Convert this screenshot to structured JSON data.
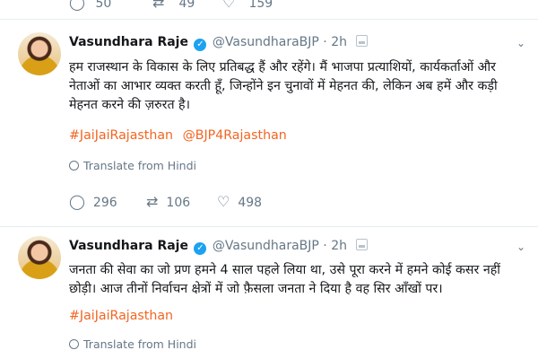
{
  "prev_tweet_actions": {
    "replies": "50",
    "retweets": "49",
    "likes": "159"
  },
  "tweets": [
    {
      "name": "Vasundhara Raje",
      "handle": "@VasundharaBJP",
      "separator": "·",
      "time": "2h",
      "text": "हम राजस्थान के विकास के लिए प्रतिबद्ध हैं और रहेंगे। मैं भाजपा प्रत्याशियों, कार्यकर्ताओं और नेताओं का आभार व्यक्त करती हूँ, जिन्होंने इन चुनावों में मेहनत की, लेकिन अब हमें और कड़ी मेहनत करने की ज़रुरत है।",
      "tags": [
        "#JaiJaiRajasthan",
        "@BJP4Rajasthan"
      ],
      "translate": "Translate from Hindi",
      "replies": "296",
      "retweets": "106",
      "likes": "498"
    },
    {
      "name": "Vasundhara Raje",
      "handle": "@VasundharaBJP",
      "separator": "·",
      "time": "2h",
      "text": "जनता की सेवा का जो प्रण हमने 4 साल पहले लिया था, उसे पूरा करने में हमने कोई कसर नहीं छोड़ी। आज तीनों निर्वाचन क्षेत्रों में जो फ़ैसला जनता ने दिया है वह सिर आँखों पर।",
      "tags": [
        "#JaiJaiRajasthan"
      ],
      "translate": "Translate from Hindi"
    }
  ],
  "icons": {
    "reply": "reply-icon",
    "retweet": "retweet-icon",
    "like": "heart-icon",
    "verified": "verified-badge-icon",
    "caret": "chevron-down-icon",
    "globe": "globe-icon"
  },
  "colors": {
    "hashtag": "#f26522",
    "muted": "#657786",
    "verified": "#1da1f2"
  }
}
